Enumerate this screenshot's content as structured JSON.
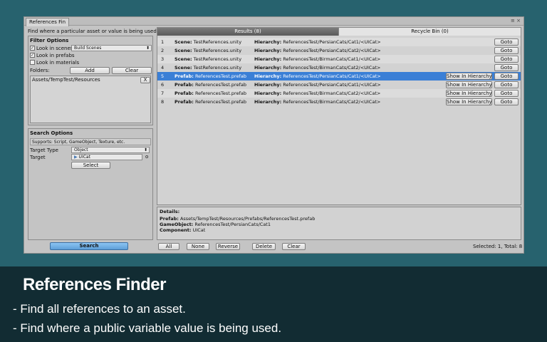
{
  "window": {
    "tab_title": "References Fin",
    "controls": "≡ ×"
  },
  "left": {
    "hint": "Find where a particular asset or value is being used.",
    "filter": {
      "title": "Filter Options",
      "look_in_scenes": "Look in scenes",
      "scenes_select": "Build Scenes",
      "look_in_prefabs": "Look in prefabs",
      "look_in_materials": "Look in materials",
      "look_in_scenes_checked": true,
      "look_in_prefabs_checked": true,
      "look_in_materials_checked": false,
      "folders_label": "Folders:",
      "add_label": "Add",
      "clear_label": "Clear",
      "folder_item": "Assets/TempTest/Resources",
      "remove_label": "X"
    },
    "search": {
      "title": "Search Options",
      "supports": "Supports: Script, GameObject, Texture, etc.",
      "target_type_label": "Target Type",
      "target_type_value": "Object",
      "target_label": "Target",
      "target_value": "UICat",
      "target_dot": "o",
      "select_label": "Select"
    },
    "search_button": "Search"
  },
  "results": {
    "tab_results": "Results (8)",
    "tab_recycle": "Recycle Bin (0)",
    "goto_label": "Goto",
    "show_label": "Show In Hierarchy",
    "hierarchy_key": "Hierarchy:",
    "rows": [
      {
        "num": "1",
        "kind": "Scene:",
        "asset": "TestReferences.unity",
        "hier": "ReferencesTest/PersianCats/Cat1/<UICat>",
        "show": false,
        "selected": false
      },
      {
        "num": "2",
        "kind": "Scene:",
        "asset": "TestReferences.unity",
        "hier": "ReferencesTest/PersianCats/Cat2/<UICat>",
        "show": false,
        "selected": false
      },
      {
        "num": "3",
        "kind": "Scene:",
        "asset": "TestReferences.unity",
        "hier": "ReferencesTest/BirmanCats/Cat1/<UICat>",
        "show": false,
        "selected": false
      },
      {
        "num": "4",
        "kind": "Scene:",
        "asset": "TestReferences.unity",
        "hier": "ReferencesTest/BirmanCats/Cat2/<UICat>",
        "show": false,
        "selected": false
      },
      {
        "num": "5",
        "kind": "Prefab:",
        "asset": "ReferencesTest.prefab",
        "hier": "ReferencesTest/PersianCats/Cat1/<UICat>",
        "show": true,
        "selected": true
      },
      {
        "num": "6",
        "kind": "Prefab:",
        "asset": "ReferencesTest.prefab",
        "hier": "ReferencesTest/PersianCats/Cat1/<UICat>",
        "show": true,
        "selected": false
      },
      {
        "num": "7",
        "kind": "Prefab:",
        "asset": "ReferencesTest.prefab",
        "hier": "ReferencesTest/BirmanCats/Cat2/<UICat>",
        "show": true,
        "selected": false
      },
      {
        "num": "8",
        "kind": "Prefab:",
        "asset": "ReferencesTest.prefab",
        "hier": "ReferencesTest/BirmanCats/Cat2/<UICat>",
        "show": true,
        "selected": false
      }
    ]
  },
  "details": {
    "title": "Details:",
    "prefab_key": "Prefab:",
    "prefab_val": "Assets/TempTest/Resources/Prefabs/ReferencesTest.prefab",
    "go_key": "GameObject:",
    "go_val": "ReferencesTest/PersianCats/Cat1",
    "comp_key": "Component:",
    "comp_val": "UICat"
  },
  "bottom_bar": {
    "all": "All",
    "none": "None",
    "reverse": "Reverse",
    "delete": "Delete",
    "clear": "Clear",
    "status": "Selected: 1, Total: 8"
  },
  "promo": {
    "title": "References Finder",
    "line1": "- Find all references to an asset.",
    "line2": "- Find where a public variable value is being used."
  },
  "colors": {
    "selected_row": "#3a7fd6",
    "search_button": "#6aaee8"
  }
}
